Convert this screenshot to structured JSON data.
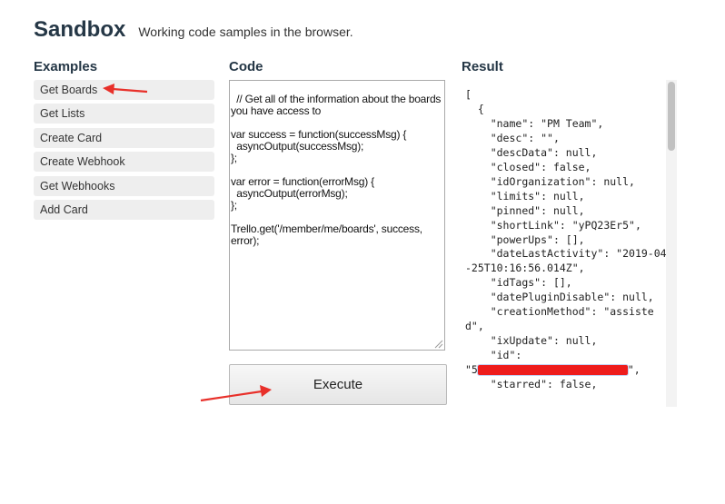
{
  "header": {
    "title": "Sandbox",
    "subtitle": "Working code samples in the browser."
  },
  "columns": {
    "examples": "Examples",
    "code": "Code",
    "result": "Result"
  },
  "examples": [
    {
      "label": "Get Boards"
    },
    {
      "label": "Get Lists"
    },
    {
      "label": "Create Card"
    },
    {
      "label": "Create Webhook"
    },
    {
      "label": "Get Webhooks"
    },
    {
      "label": "Add Card"
    }
  ],
  "code": {
    "text": "// Get all of the information about the boards you have access to\n\nvar success = function(successMsg) {\n  asyncOutput(successMsg);\n};\n\nvar error = function(errorMsg) {\n  asyncOutput(errorMsg);\n};\n\nTrello.get('/member/me/boards', success, error);"
  },
  "execute_label": "Execute",
  "result": {
    "before_id": "[\n  {\n    \"name\": \"PM Team\",\n    \"desc\": \"\",\n    \"descData\": null,\n    \"closed\": false,\n    \"idOrganization\": null,\n    \"limits\": null,\n    \"pinned\": null,\n    \"shortLink\": \"yPQ23Er5\",\n    \"powerUps\": [],\n    \"dateLastActivity\": \"2019-04-25T10:16:56.014Z\",\n    \"idTags\": [],\n    \"datePluginDisable\": null,\n    \"creationMethod\": \"assisted\",\n    \"ixUpdate\": null,\n    \"id\":\n",
    "id_open": "\"5",
    "id_close": "\",",
    "after_id": "\n    \"starred\": false,"
  },
  "colors": {
    "heading": "#253746",
    "annotation_arrow": "#e8302a",
    "redaction": "#ee1c1c"
  }
}
